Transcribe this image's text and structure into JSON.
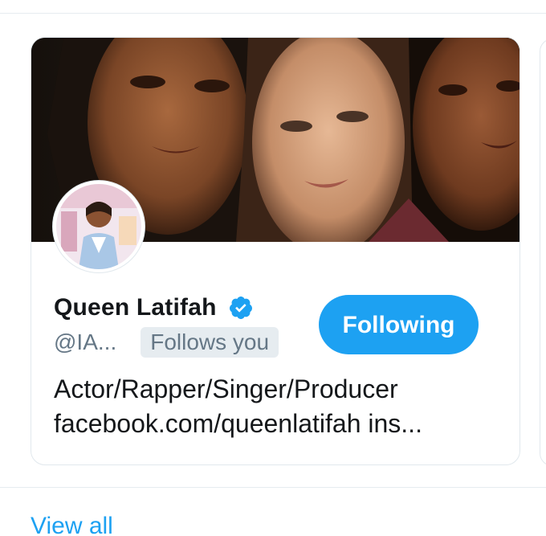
{
  "card": {
    "name": "Queen Latifah",
    "handle": "@IA...",
    "follows_badge": "Follows you",
    "follow_button_label": "Following",
    "bio_lines": [
      "Actor/Rapper/Singer/Producer",
      "facebook.com/queenlatifah ins..."
    ],
    "verified_icon": "verified-badge-icon"
  },
  "footer": {
    "view_all_label": "View all"
  },
  "colors": {
    "accent": "#1da1f2",
    "name_text": "#14171a",
    "secondary_text": "#657786",
    "badge_bg": "#e6ecf0",
    "border": "#e1e8ed"
  }
}
